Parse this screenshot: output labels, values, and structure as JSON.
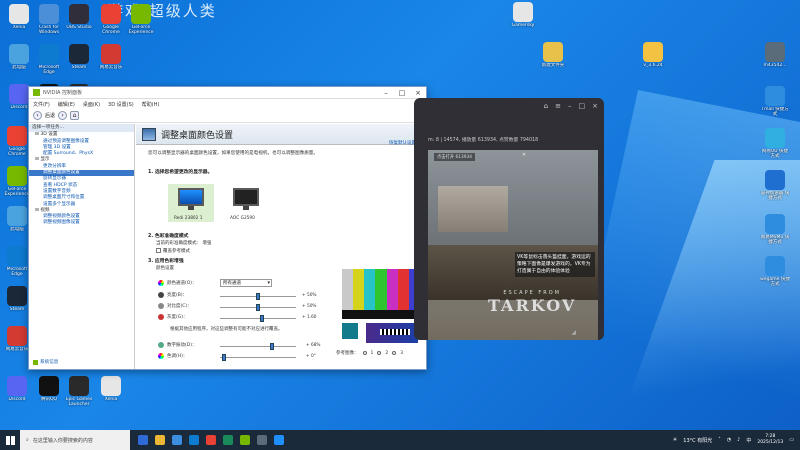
{
  "watermark": "游戏 超级人类",
  "desktop": {
    "left_icons": [
      {
        "label": "Xenia",
        "color": "#e6e6e6"
      },
      {
        "label": "Clash for Windows",
        "color": "#4a8fd8"
      },
      {
        "label": "OBS Studio",
        "color": "#302e3a"
      },
      {
        "label": "Google Chrome",
        "color": "#e94235"
      },
      {
        "label": "GeForce Experience",
        "color": "#76b900"
      },
      {
        "label": "此电脑",
        "color": "#4aa3df"
      },
      {
        "label": "Microsoft Edge",
        "color": "#0c7bd0"
      },
      {
        "label": "Steam",
        "color": "#1b2838"
      },
      {
        "label": "网易云音乐",
        "color": "#d33a31"
      },
      {
        "label": "Discord",
        "color": "#5865f2"
      },
      {
        "label": "腾讯QQ",
        "color": "#111"
      },
      {
        "label": "Epic Games Launcher",
        "color": "#2a2a2a"
      }
    ],
    "right_icons": [
      {
        "label": "新建文件夹",
        "color": "#e8c14a"
      },
      {
        "label": "v_3.6.24",
        "color": "#f3c243"
      },
      {
        "label": "m43542...",
        "color": "#5a6b7a"
      },
      {
        "label": "Tmall 快捷方式",
        "color": "#2f8de0"
      },
      {
        "label": "网易UU 快捷方式",
        "color": "#2fb0e0"
      },
      {
        "label": "雷神加速器 快捷方式",
        "color": "#1f6fd0"
      },
      {
        "label": "网易MuMu 快捷方式",
        "color": "#2f8de0"
      },
      {
        "label": "wegame 快捷方式",
        "color": "#2f8de0"
      },
      {
        "label": "Gamersky",
        "color": "#e6e6e6"
      }
    ]
  },
  "nvidia": {
    "window_title": "NVIDIA 控制面板",
    "menu": [
      "文件(F)",
      "编辑(E)",
      "桌面(K)",
      "3D 设置(S)",
      "帮助(H)"
    ],
    "toolbar": {
      "back": "后退"
    },
    "task_label": "选择一项任务...",
    "tree": [
      {
        "text": "3D 设置",
        "level": 0
      },
      {
        "text": "通过预览调整图像设置",
        "level": 1
      },
      {
        "text": "管理 3D 设置",
        "level": 1
      },
      {
        "text": "配置 Surround、PhysX",
        "level": 1
      },
      {
        "text": "显示",
        "level": 0
      },
      {
        "text": "更改分辨率",
        "level": 1
      },
      {
        "text": "调整桌面颜色设置",
        "level": 1,
        "selected": true
      },
      {
        "text": "旋转显示器",
        "level": 1
      },
      {
        "text": "查看 HDCP 状态",
        "level": 1
      },
      {
        "text": "设置数字音频",
        "level": 1
      },
      {
        "text": "调整桌面尺寸和位置",
        "level": 1
      },
      {
        "text": "设置多个显示器",
        "level": 1
      },
      {
        "text": "视频",
        "level": 0
      },
      {
        "text": "调整视频颜色设置",
        "level": 1
      },
      {
        "text": "调整视频图像设置",
        "level": 1
      }
    ],
    "system_info": "系统信息",
    "page_title": "调整桌面颜色设置",
    "restore_defaults": "恢复默认设置",
    "description": "您可以调整显示器的桌面颜色设置，如果您使用的是电视机，也可以调整图像质量。",
    "section1": "1. 选择您希望更改的显示器。",
    "monitors": [
      {
        "label": "Redi 23802 1",
        "selected": true
      },
      {
        "label": "AOC G2590"
      }
    ],
    "section2": "2. 色彩准确度模式",
    "mode_current": "当前的彩准确度模式： 增强",
    "override_mode": "覆盖参考模式",
    "section3": "3. 应用色彩增强",
    "color_settings": "颜色设置",
    "channel_label": "颜色通道(O)：",
    "channel_value": "所有通道",
    "sliders": [
      {
        "label": "亮度(B)：",
        "value_text": "+ 50%",
        "level": 0.5,
        "dot": "#444"
      },
      {
        "label": "对比度(C)：",
        "value_text": "+ 50%",
        "level": 0.5,
        "dot": "#888"
      },
      {
        "label": "灰度(G)：",
        "value_text": "+ 1.60",
        "level": 0.55,
        "dot": "#c33"
      }
    ],
    "note": "根据其他应用程序，对这些调整有可能不对应进行覆盖。",
    "vibrance_label": "数字振动(D)：",
    "vibrance_value": "+ 68%",
    "vibrance_level": 0.68,
    "hue_label": "色调(H)：",
    "hue_value": "+ 0°",
    "hue_level": 0.05,
    "reference_image": "参考图像：",
    "reference_options": [
      "1",
      "2",
      "3"
    ]
  },
  "player": {
    "info_line": "m: 8 | 14574, 播放量 613934, 点赞数量 794018",
    "chip": "点击打开 613934",
    "caption": "VK等鼠标击落头盔挂面，游戏运的策略下面像是爆发游戏的，VK专为打造属于自由的体验体验",
    "logo_small": "ESCAPE FROM",
    "logo_big": "TARKOV"
  },
  "taskbar": {
    "search_placeholder": "在这里输入你要搜索的内容",
    "weather": "13°C 有阳光",
    "time": "7:28",
    "date": "2025/12/13",
    "ime": "中"
  }
}
